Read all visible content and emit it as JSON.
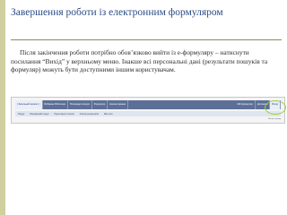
{
  "slide": {
    "title": "Завершення роботи із електронним формуляром",
    "paragraph": "Після закінчення роботи потрібно обов’язково вийти із е-формуляру – натиснути посилання “Вихід” у верхньому меню. Інакше всі персональні дані (результати пошуків та формуляр) можуть бути доступними іншим користувачам."
  },
  "screenshot": {
    "top_menu": [
      "( Загальний каталог )",
      "Вибрана бібліотека",
      "Попередні пошуки",
      "Формуляр",
      "Налаштування",
      "Мій формуляр",
      "Допомога",
      "Вихід"
    ],
    "second_row": [
      "Пошук",
      "Розширений пошук",
      "Переглянути список",
      "Список результатів",
      "Мої сесії"
    ],
    "footer_text": "Меню пошуку"
  }
}
